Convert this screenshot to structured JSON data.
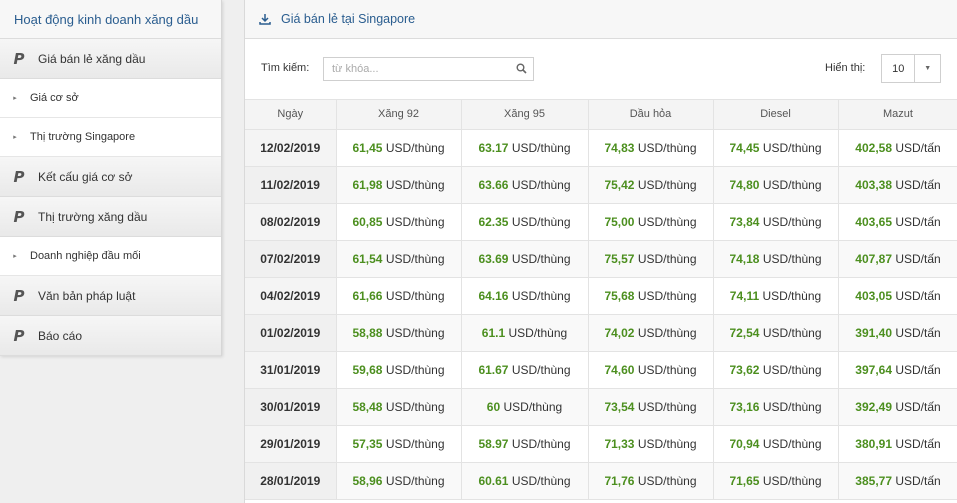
{
  "sidebar": {
    "title": "Hoạt động kinh doanh xăng dầu",
    "items": [
      {
        "type": "main",
        "label": "Giá bán lẻ xăng dầu"
      },
      {
        "type": "sub",
        "label": "Giá cơ sở"
      },
      {
        "type": "sub",
        "label": "Thị trường Singapore"
      },
      {
        "type": "main",
        "label": "Kết cấu giá cơ sở"
      },
      {
        "type": "main",
        "label": "Thị trường xăng dầu"
      },
      {
        "type": "sub",
        "label": "Doanh nghiệp đầu mối"
      },
      {
        "type": "main",
        "label": "Văn bản pháp luật"
      },
      {
        "type": "main",
        "label": "Báo cáo"
      }
    ],
    "main_icon": "P",
    "sub_icon": "▸"
  },
  "panel": {
    "title": "Giá bán lẻ tại Singapore",
    "search_label": "Tìm kiếm:",
    "search_placeholder": "từ khóa...",
    "show_label": "Hiển thị:",
    "page_size": "10"
  },
  "table": {
    "headers": [
      "Ngày",
      "Xăng 92",
      "Xăng 95",
      "Dầu hỏa",
      "Diesel",
      "Mazut"
    ],
    "rows": [
      {
        "date": "12/02/2019",
        "cells": [
          [
            "61,45",
            "USD/thùng"
          ],
          [
            "63.17",
            "USD/thùng"
          ],
          [
            "74,83",
            "USD/thùng"
          ],
          [
            "74,45",
            "USD/thùng"
          ],
          [
            "402,58",
            "USD/tấn"
          ]
        ]
      },
      {
        "date": "11/02/2019",
        "cells": [
          [
            "61,98",
            "USD/thùng"
          ],
          [
            "63.66",
            "USD/thùng"
          ],
          [
            "75,42",
            "USD/thùng"
          ],
          [
            "74,80",
            "USD/thùng"
          ],
          [
            "403,38",
            "USD/tấn"
          ]
        ]
      },
      {
        "date": "08/02/2019",
        "cells": [
          [
            "60,85",
            "USD/thùng"
          ],
          [
            "62.35",
            "USD/thùng"
          ],
          [
            "75,00",
            "USD/thùng"
          ],
          [
            "73,84",
            "USD/thùng"
          ],
          [
            "403,65",
            "USD/tấn"
          ]
        ]
      },
      {
        "date": "07/02/2019",
        "cells": [
          [
            "61,54",
            "USD/thùng"
          ],
          [
            "63.69",
            "USD/thùng"
          ],
          [
            "75,57",
            "USD/thùng"
          ],
          [
            "74,18",
            "USD/thùng"
          ],
          [
            "407,87",
            "USD/tấn"
          ]
        ]
      },
      {
        "date": "04/02/2019",
        "cells": [
          [
            "61,66",
            "USD/thùng"
          ],
          [
            "64.16",
            "USD/thùng"
          ],
          [
            "75,68",
            "USD/thùng"
          ],
          [
            "74,11",
            "USD/thùng"
          ],
          [
            "403,05",
            "USD/tấn"
          ]
        ]
      },
      {
        "date": "01/02/2019",
        "cells": [
          [
            "58,88",
            "USD/thùng"
          ],
          [
            "61.1",
            "USD/thùng"
          ],
          [
            "74,02",
            "USD/thùng"
          ],
          [
            "72,54",
            "USD/thùng"
          ],
          [
            "391,40",
            "USD/tấn"
          ]
        ]
      },
      {
        "date": "31/01/2019",
        "cells": [
          [
            "59,68",
            "USD/thùng"
          ],
          [
            "61.67",
            "USD/thùng"
          ],
          [
            "74,60",
            "USD/thùng"
          ],
          [
            "73,62",
            "USD/thùng"
          ],
          [
            "397,64",
            "USD/tấn"
          ]
        ]
      },
      {
        "date": "30/01/2019",
        "cells": [
          [
            "58,48",
            "USD/thùng"
          ],
          [
            "60",
            "USD/thùng"
          ],
          [
            "73,54",
            "USD/thùng"
          ],
          [
            "73,16",
            "USD/thùng"
          ],
          [
            "392,49",
            "USD/tấn"
          ]
        ]
      },
      {
        "date": "29/01/2019",
        "cells": [
          [
            "57,35",
            "USD/thùng"
          ],
          [
            "58.97",
            "USD/thùng"
          ],
          [
            "71,33",
            "USD/thùng"
          ],
          [
            "70,94",
            "USD/thùng"
          ],
          [
            "380,91",
            "USD/tấn"
          ]
        ]
      },
      {
        "date": "28/01/2019",
        "cells": [
          [
            "58,96",
            "USD/thùng"
          ],
          [
            "60.61",
            "USD/thùng"
          ],
          [
            "71,76",
            "USD/thùng"
          ],
          [
            "71,65",
            "USD/thùng"
          ],
          [
            "385,77",
            "USD/tấn"
          ]
        ]
      }
    ]
  },
  "colors": {
    "accent": "#2a5d8f",
    "value_green": "#4c8f1f"
  },
  "icons": {
    "panel_title": "download-icon",
    "search": "search-icon",
    "select": "caret-down-icon"
  }
}
